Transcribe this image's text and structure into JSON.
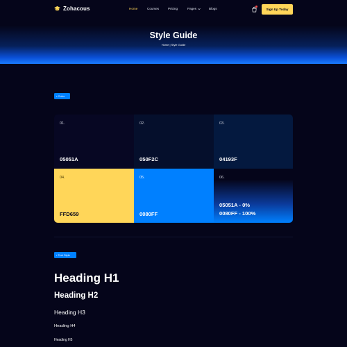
{
  "brand": {
    "name": "Zohacous",
    "logo_icon": "graduation-cap-icon",
    "accent": "#FFD659"
  },
  "nav": {
    "items": [
      {
        "label": "Home",
        "active": true
      },
      {
        "label": "Courses"
      },
      {
        "label": "Pricing"
      },
      {
        "label": "Pages"
      },
      {
        "label": "Blogs"
      }
    ],
    "cart_icon": "shopping-bag-icon",
    "signup_label": "Sign Up Today"
  },
  "hero": {
    "title": "Style Guide",
    "breadcrumb": {
      "home": "Home",
      "separator": " | ",
      "current": "Style Guide"
    }
  },
  "color_section": {
    "tag": "Color",
    "swatches": [
      {
        "num": "01.",
        "value": "05051A",
        "color": "#05051A"
      },
      {
        "num": "02.",
        "value": "050F2C",
        "color": "#050F2C"
      },
      {
        "num": "03.",
        "value": "04193F",
        "color": "#04193F"
      },
      {
        "num": "04.",
        "value": "FFD659",
        "color": "#FFD659"
      },
      {
        "num": "05.",
        "value": "0080FF",
        "color": "#0080FF"
      },
      {
        "num": "06.",
        "value_line1": "05051A - 0%",
        "value_line2": "0080FF - 100%"
      }
    ]
  },
  "text_section": {
    "tag": "Text Style",
    "h1": "Heading H1",
    "h2": "Heading H2",
    "h3": "Heading H3",
    "h4": "Heading H4",
    "h5": "Heading H5"
  }
}
